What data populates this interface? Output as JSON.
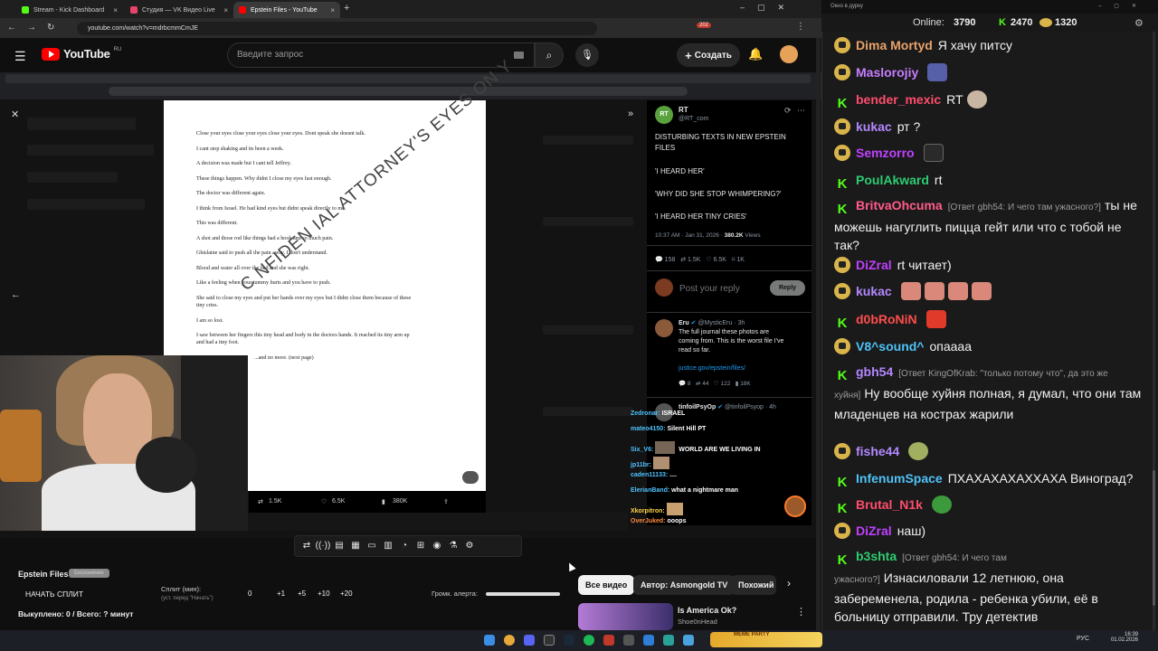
{
  "browser": {
    "tabs": [
      {
        "label": "Stream - Kick Dashboard",
        "color": "#53fc18"
      },
      {
        "label": "Студия — VK Видео Live",
        "color": "#e8446a"
      },
      {
        "label": "Epstein Files - YouTube",
        "color": "#ff0000"
      }
    ],
    "url": "youtube.com/watch?v=mdrbcmmCmJE",
    "notification_count": "202"
  },
  "youtube": {
    "logo": "YouTube",
    "region": "RU",
    "search_placeholder": "Введите запрос",
    "create_label": "Создать"
  },
  "document": {
    "lines": [
      "Close your eyes close your eyes close your eyes. Dont speak she doesnt talk.",
      "I cant stop shaking and its been a week.",
      "A decision was made but I cant tell Jeffrey.",
      "These things happen. Why didnt I close my eyes fast enough.",
      "The doctor was different again.",
      "I think from Israel.     He had kind eyes but didnt speak directly to me.",
      "This was different.",
      "A shot and those rod like things had a hook and so much pain.",
      "Ghislaine said to push all the pain away. I don't understand.",
      "Blood and water all over the bed and she was right.",
      "Like a feeling when your tummy hurts and you have to push.",
      "She said to close my eyes and put her hands over my eyes but I didnt close them because of these",
      "tiny cries.",
      "I am so lost.",
      "I saw between her fingers this tiny head and body in the doctors hands. It reached its tiny arm up",
      "and had a tiny foot.",
      "...and no more.   (next page)"
    ],
    "watermark": "C NFIDEN IAL   ATTORNEY'S EYES ON Y",
    "stats": {
      "reposts": "1.5K",
      "likes": "6.5K",
      "views": "380K"
    }
  },
  "tweet": {
    "author": "RT",
    "handle": "@RT_com",
    "lines": [
      "DISTURBING TEXTS IN NEW EPSTEIN",
      "FILES",
      "'I HEARD HER'",
      "'WHY DID SHE STOP WHIMPERING?'",
      "'I HEARD HER TINY CRIES'"
    ],
    "meta": "10:37 AM · Jan 31, 2026 · ",
    "views": "380.2K",
    "views_label": " Views",
    "actions": {
      "replies": "158",
      "reposts": "1.5K",
      "likes": "6.5K",
      "bookmarks": "1K"
    },
    "reply_placeholder": "Post your reply",
    "reply_button": "Reply",
    "reply1": {
      "author": "Eru",
      "handle": "@MysticEru · 3h",
      "lines": [
        "The full journal these photos are",
        "coming from. This is the worst file I've",
        "read so far."
      ],
      "link": "justice.gov/epstein/files/",
      "stats": {
        "replies": "8",
        "reposts": "44",
        "likes": "122",
        "views": "18K"
      }
    },
    "reply2": {
      "author": "tinfoilPsyOp",
      "handle": "@tinfoilPsyop · 4h"
    }
  },
  "overlay_chat": [
    {
      "user": "Zedronar:",
      "text": " ISRAEL",
      "color": "#4fc3ff"
    },
    {
      "user": "mateo4150:",
      "text": " Silent Hill PT",
      "color": "#4fc3ff"
    },
    {
      "user": "Six_V6:",
      "text": " WORLD ARE WE LIVING IN",
      "color": "#4fc3ff"
    },
    {
      "user": "jp11br:",
      "text": "",
      "color": "#4fc3ff"
    },
    {
      "user": "caden11133:",
      "text": " ....",
      "color": "#4fc3ff"
    },
    {
      "user": "ElerianBand:",
      "text": " what a nightmare man",
      "color": "#4fc3ff"
    },
    {
      "user": "Xkorpitron:",
      "text": "",
      "color": "#ffd54a"
    },
    {
      "user": "OverJuked:",
      "text": " ooops",
      "color": "#ff8a3d"
    }
  ],
  "panel": {
    "title": "Epstein Files",
    "tag": "Бесконечно",
    "start_split": "НАЧАТЬ СПЛИТ",
    "split_label": "Сплит (мин):",
    "split_hint": "(уст. перед \"Начать\")",
    "split_value": "0",
    "increments": [
      "+1",
      "+5",
      "+10",
      "+20"
    ],
    "alert_label": "Громк. алерта:",
    "summary": "Выкуплено: 0 / Всего: ? минут",
    "chips": [
      "Все видео",
      "Автор: Asmongold TV",
      "Похожий"
    ],
    "rec_title": "Is America Ok?",
    "rec_channel": "Shoe0nHead"
  },
  "chat": {
    "window_title": "Окно в дурку",
    "online_label": "Online:",
    "online": "3790",
    "kick_count": "2470",
    "tw_count": "1320",
    "messages": [
      {
        "badge": "t",
        "nick": "Dima Mortyd",
        "color": "#e8a36a",
        "text": "Я хачу питсу"
      },
      {
        "badge": "t",
        "nick": "Maslorojiy",
        "color": "#c77dff",
        "text": ""
      },
      {
        "badge": "k",
        "nick": "bender_mexic",
        "color": "#ff4d6d",
        "text": "RT"
      },
      {
        "badge": "t",
        "nick": "kukac",
        "color": "#b388ff",
        "text": "рт ?"
      },
      {
        "badge": "t",
        "nick": "Semzorro",
        "color": "#c040ff",
        "text": ""
      },
      {
        "badge": "k",
        "nick": "PoulAkward",
        "color": "#2ecc71",
        "text": "rt"
      },
      {
        "badge": "k",
        "nick": "BritvaOhcuma",
        "color": "#ff5b8a",
        "reply": "[Ответ gbh54: И чего там ужасного?]",
        "text": "ты не можешь нагуглить пицца гейт или что с тобой не так?"
      },
      {
        "badge": "t",
        "nick": "DiZral",
        "color": "#c040ff",
        "text": "rt читает)"
      },
      {
        "badge": "t",
        "nick": "kukac",
        "color": "#b388ff",
        "text": ""
      },
      {
        "badge": "k",
        "nick": "d0bRoNiN",
        "color": "#ff4d4d",
        "text": ""
      },
      {
        "badge": "t",
        "nick": "V8^sound^",
        "color": "#4fc3f7",
        "text": "опаааа"
      },
      {
        "badge": "k",
        "nick": "gbh54",
        "color": "#b388ff",
        "reply": "[Ответ KingOfKrab: \"только потому что\", да это же хуйня]",
        "text": "Ну вообще хуйня полная, я думал, что они там младенцев на кострах жарили"
      },
      {
        "badge": "t",
        "nick": "fishe44",
        "color": "#b388ff",
        "text": ""
      },
      {
        "badge": "k",
        "nick": "InfenumSpace",
        "color": "#4fc3f7",
        "text": "ПХАХАХАХАХХАХА Виноград?"
      },
      {
        "badge": "k",
        "nick": "Brutal_N1k",
        "color": "#ff4d6d",
        "text": ""
      },
      {
        "badge": "t",
        "nick": "DiZral",
        "color": "#c040ff",
        "text": "наш)"
      },
      {
        "badge": "k",
        "nick": "b3shta",
        "color": "#2ecc71",
        "reply": "[Ответ gbh54: И чего там ужасного?]",
        "text": "Изнасиловали 12 летнюю, она забеременела, родила - ребенка убили, её в больницу отправили. Тру детектив"
      }
    ]
  },
  "taskbar": {
    "lang": "РУС",
    "time": "16:39",
    "date": "01.02.2026",
    "meme_label": "MEME PARTY"
  }
}
